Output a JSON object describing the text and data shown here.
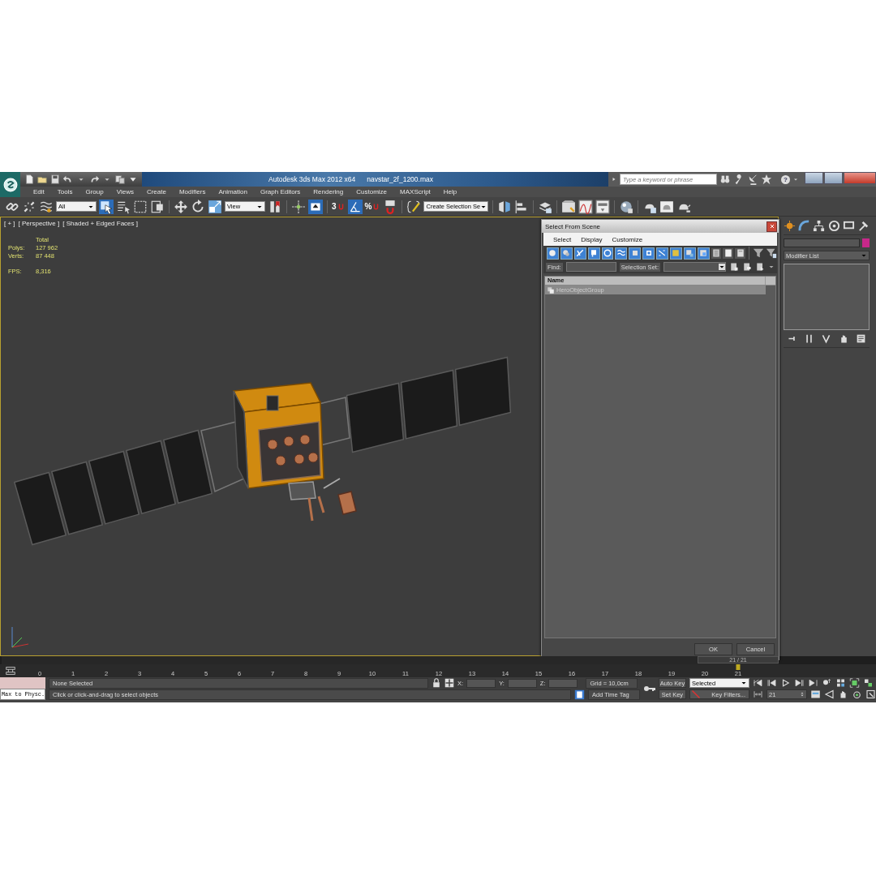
{
  "title_bar": {
    "app_title": "Autodesk 3ds Max 2012 x64",
    "file_name": "navstar_2f_1200.max",
    "search": {
      "placeholder": "Type a keyword or phrase"
    },
    "help": "?"
  },
  "menus": [
    "Edit",
    "Tools",
    "Group",
    "Views",
    "Create",
    "Modifiers",
    "Animation",
    "Graph Editors",
    "Rendering",
    "Customize",
    "MAXScript",
    "Help"
  ],
  "toolbar": {
    "selection_filter": "All",
    "reference_coord": "View",
    "snap_label": "3",
    "percent_label": "%",
    "named_selection": "Create Selection Se"
  },
  "viewport": {
    "labels": [
      "[ + ]",
      "[ Perspective ]",
      "[ Shaded + Edged Faces ]"
    ],
    "stats_header": "Total",
    "stats": [
      {
        "label": "Polys:",
        "value": "127 962"
      },
      {
        "label": "Verts:",
        "value": "87 448"
      }
    ],
    "fps": {
      "label": "FPS:",
      "value": "8,316"
    }
  },
  "dialog": {
    "title": "Select From Scene",
    "menus": [
      "Select",
      "Display",
      "Customize"
    ],
    "toggles": [
      {
        "on": true
      },
      {
        "on": true
      },
      {
        "on": true
      },
      {
        "on": true
      },
      {
        "on": true
      },
      {
        "on": true
      },
      {
        "on": true
      },
      {
        "on": true
      },
      {
        "on": true
      },
      {
        "on": true
      },
      {
        "on": true
      },
      {
        "on": true
      },
      {
        "on": false
      },
      {
        "on": false
      },
      {
        "on": false
      }
    ],
    "find_label": "Find:",
    "selection_set_label": "Selection Set:",
    "columns": [
      "Name"
    ],
    "rows": [
      {
        "name": "HeroObjectGroup",
        "selected": true
      }
    ],
    "buttons": [
      "OK",
      "Cancel"
    ]
  },
  "command_panel": {
    "object_swatch": {
      "color": "#c8288a"
    },
    "modifier_list": "Modifier List"
  },
  "timeline": {
    "slider_label": "21 / 21",
    "level": 1,
    "ticks": [
      "0",
      "1",
      "2",
      "3",
      "4",
      "5",
      "6",
      "7",
      "8",
      "9",
      "10",
      "11",
      "12",
      "13",
      "14",
      "15",
      "16",
      "17",
      "18",
      "19",
      "20",
      "21"
    ]
  },
  "status": {
    "script_listener": "Max to Physc.",
    "selection": "None Selected",
    "prompt": "Click or click-and-drag to select objects",
    "coords": [
      "X:",
      "Y:",
      "Z:"
    ],
    "grid": "Grid = 10,0cm",
    "add_time_tag": "Add Time Tag",
    "auto_key": "Auto Key",
    "set_key": "Set Key",
    "key_mode": "Selected",
    "key_filters": "Key Filters...",
    "frame": "21"
  }
}
